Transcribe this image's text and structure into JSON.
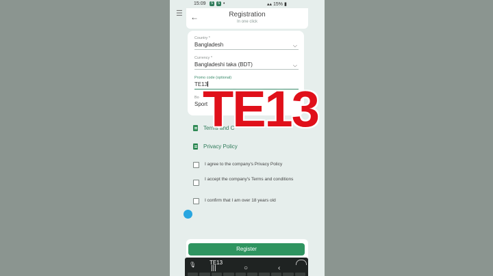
{
  "status_bar": {
    "time": "15:09",
    "battery": "15%"
  },
  "header": {
    "title": "Registration",
    "subtitle": "In one click"
  },
  "form": {
    "country": {
      "label": "Country *",
      "value": "Bangladesh"
    },
    "currency": {
      "label": "Currency *",
      "value": "Bangladeshi taka (BDT)"
    },
    "promo": {
      "label": "Promo code (optional)",
      "value": "TE13"
    },
    "bonus": {
      "label": "Bo",
      "value": "Sport"
    }
  },
  "documents": [
    {
      "label": "Terms and C"
    },
    {
      "label": "Privacy Policy"
    }
  ],
  "checkboxes": [
    {
      "label": "I agree to the company's Privacy Policy",
      "checked": false
    },
    {
      "label": "I accept the company's Terms and conditions",
      "checked": false
    },
    {
      "label": "I confirm that I am over 18 years old",
      "checked": false
    }
  ],
  "register_button": {
    "label": "Register"
  },
  "keyboard": {
    "suggestion": "TE13"
  },
  "overlay": {
    "text": "TE13",
    "color": "#e0101a"
  },
  "colors": {
    "accent": "#2f9460",
    "link": "#2f7b5a",
    "background": "#e6eeec"
  }
}
